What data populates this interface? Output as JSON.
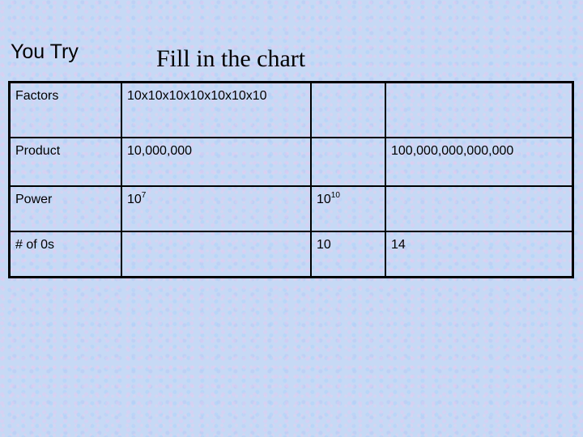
{
  "slide": {
    "corner_label": "You Try",
    "title": "Fill in the chart"
  },
  "table": {
    "rows": [
      {
        "label": "Factors",
        "cells": [
          {
            "text": "10x10x10x10x10x10x10",
            "span": 1
          },
          {
            "text": "",
            "span": 1
          },
          {
            "text": "",
            "span": 1
          }
        ]
      },
      {
        "label": "Product",
        "cells": [
          {
            "text": "10,000,000",
            "span": 1
          },
          {
            "text": "",
            "span": 1
          },
          {
            "text": "100,000,000,000,000",
            "span": 1
          }
        ]
      },
      {
        "label": "Power",
        "cells": [
          {
            "base": "10",
            "exp": "7"
          },
          {
            "base": "10",
            "exp": "10"
          },
          {
            "base": "",
            "exp": ""
          }
        ]
      },
      {
        "label": "# of 0s",
        "cells": [
          {
            "text": ""
          },
          {
            "text": "10"
          },
          {
            "text": "14"
          }
        ]
      }
    ]
  }
}
